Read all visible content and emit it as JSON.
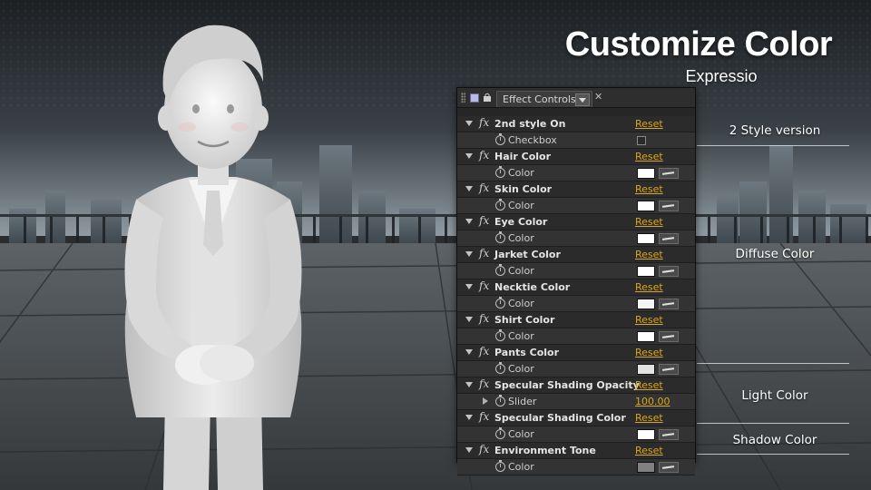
{
  "title": "Customize Color",
  "subtitle": "Expressio",
  "side_labels": [
    "2 Style version",
    "Diffuse Color",
    "Light Color",
    "Shadow Color"
  ],
  "panel": {
    "tab_label": "Effect Controls",
    "rows": [
      {
        "kind": "effect",
        "label": "2nd style On",
        "reset": "Reset"
      },
      {
        "kind": "prop",
        "label": "Checkbox",
        "control": "checkbox"
      },
      {
        "kind": "effect",
        "label": "Hair Color",
        "reset": "Reset"
      },
      {
        "kind": "prop",
        "label": "Color",
        "control": "color",
        "swatch": "#ffffff"
      },
      {
        "kind": "effect",
        "label": "Skin Color",
        "reset": "Reset"
      },
      {
        "kind": "prop",
        "label": "Color",
        "control": "color",
        "swatch": "#ffffff"
      },
      {
        "kind": "effect",
        "label": "Eye Color",
        "reset": "Reset"
      },
      {
        "kind": "prop",
        "label": "Color",
        "control": "color",
        "swatch": "#ffffff"
      },
      {
        "kind": "effect",
        "label": "Jarket Color",
        "reset": "Reset"
      },
      {
        "kind": "prop",
        "label": "Color",
        "control": "color",
        "swatch": "#ffffff"
      },
      {
        "kind": "effect",
        "label": "Necktie Color",
        "reset": "Reset"
      },
      {
        "kind": "prop",
        "label": "Color",
        "control": "color",
        "swatch": "#f4f4f4"
      },
      {
        "kind": "effect",
        "label": "Shirt Color",
        "reset": "Reset"
      },
      {
        "kind": "prop",
        "label": "Color",
        "control": "color",
        "swatch": "#ffffff"
      },
      {
        "kind": "effect",
        "label": "Pants Color",
        "reset": "Reset"
      },
      {
        "kind": "prop",
        "label": "Color",
        "control": "color",
        "swatch": "#e2e2e2"
      },
      {
        "kind": "effect",
        "label": "Specular Shading Opacity",
        "reset": "Reset"
      },
      {
        "kind": "prop",
        "label": "Slider",
        "control": "number",
        "value": "100.00",
        "expander": true
      },
      {
        "kind": "effect",
        "label": "Specular Shading Color",
        "reset": "Reset"
      },
      {
        "kind": "prop",
        "label": "Color",
        "control": "color",
        "swatch": "#ffffff"
      },
      {
        "kind": "effect",
        "label": "Environment Tone",
        "reset": "Reset"
      },
      {
        "kind": "prop",
        "label": "Color",
        "control": "color",
        "swatch": "#808080"
      }
    ]
  }
}
